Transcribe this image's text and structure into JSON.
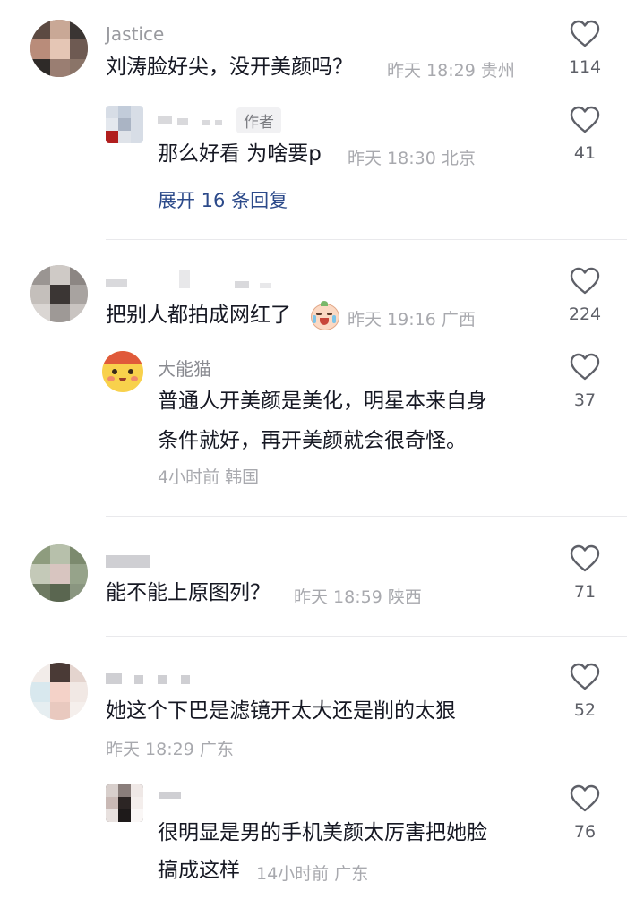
{
  "comments": [
    {
      "id": "c1",
      "name": "Jastice",
      "text": "刘涛脸好尖，没开美颜吗？",
      "meta": "昨天 18:29 贵州",
      "likes": "114",
      "reply": {
        "author_tag": "作者",
        "text": "那么好看 为啥要p",
        "meta": "昨天 18:30 北京",
        "likes": "41"
      },
      "expand_label": "展开 16 条回复"
    },
    {
      "id": "c2",
      "text": "把别人都拍成网红了",
      "emoji": "😭",
      "meta": "昨天 19:16 广西",
      "likes": "224",
      "reply": {
        "name": "大能猫",
        "text_line1": "普通人开美颜是美化，明星本来自身",
        "text_line2": "条件就好，再开美颜就会很奇怪。",
        "meta": "4小时前 韩国",
        "likes": "37"
      }
    },
    {
      "id": "c3",
      "text": "能不能上原图列？",
      "meta": "昨天 18:59 陕西",
      "likes": "71"
    },
    {
      "id": "c4",
      "text": "她这个下巴是滤镜开太大还是削的太狠",
      "meta": "昨天 18:29 广东",
      "likes": "52",
      "reply": {
        "text_line1": "很明显是男的手机美颜太厉害把她脸",
        "text_line2": "搞成这样",
        "meta": "14小时前 广东",
        "likes": "76"
      }
    }
  ],
  "colors": {
    "text": "#161823",
    "meta": "#a8a9ae",
    "link": "#2c4a8a",
    "divider": "#e9e9ec"
  },
  "icons": {
    "like": "heart-outline-icon"
  }
}
